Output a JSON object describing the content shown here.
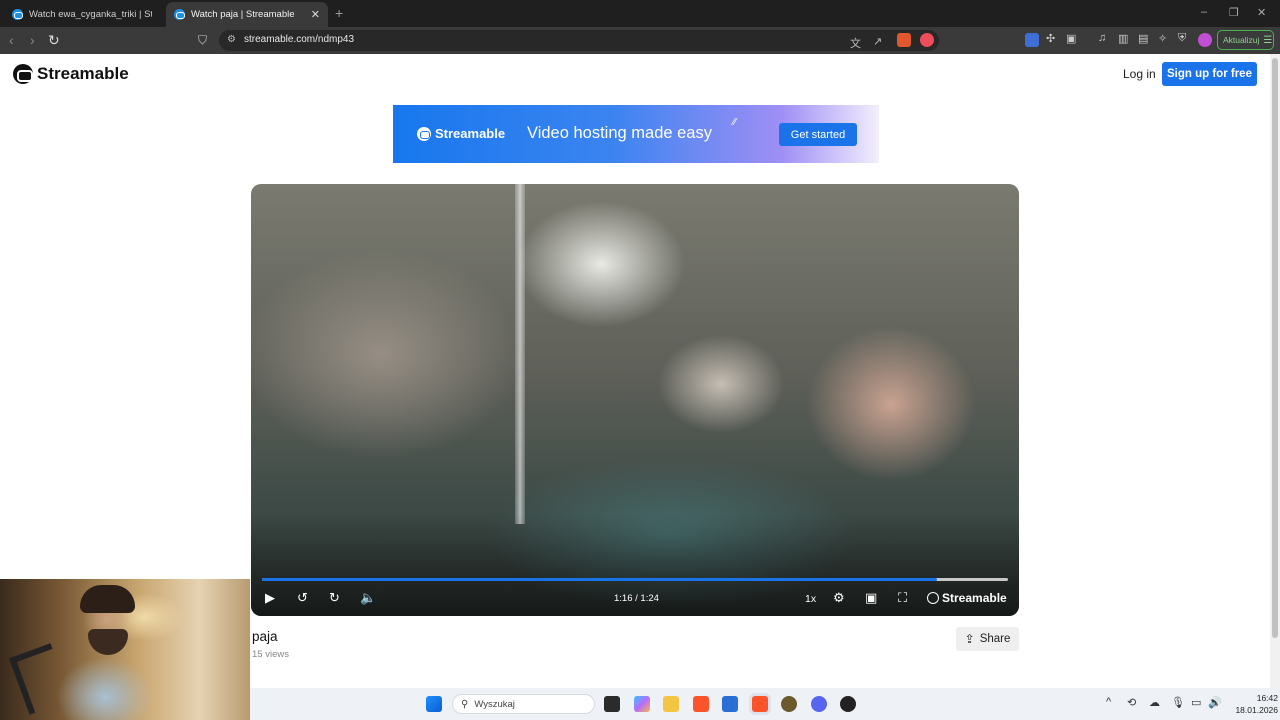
{
  "browser": {
    "tabs": [
      {
        "label": "Watch ewa_cyganka_triki | Streamabl",
        "active": false
      },
      {
        "label": "Watch paja | Streamable",
        "active": true
      }
    ],
    "new_tab": "+",
    "url": "streamable.com/ndmp43",
    "update_label": "Aktualizuj",
    "window_controls": {
      "minimize": "–",
      "restore": "❐",
      "close": "✕"
    }
  },
  "site": {
    "brand": "Streamable",
    "login": "Log in",
    "signup": "Sign up for free"
  },
  "banner": {
    "brand": "Streamable",
    "tagline": "Video hosting made easy",
    "cta": "Get started"
  },
  "player": {
    "time": "1:16 / 1:24",
    "progress": 0.905,
    "speed": "1x",
    "brand": "Streamable"
  },
  "video": {
    "title": "paja",
    "views": "15 views",
    "share": "Share"
  },
  "taskbar": {
    "search_placeholder": "Wyszukaj",
    "time": "16:42",
    "date": "18.01.2026"
  },
  "colors": {
    "accent": "#1a73e8",
    "chrome_dark": "#1f1f1f",
    "toolbar": "#3a3a3a"
  }
}
